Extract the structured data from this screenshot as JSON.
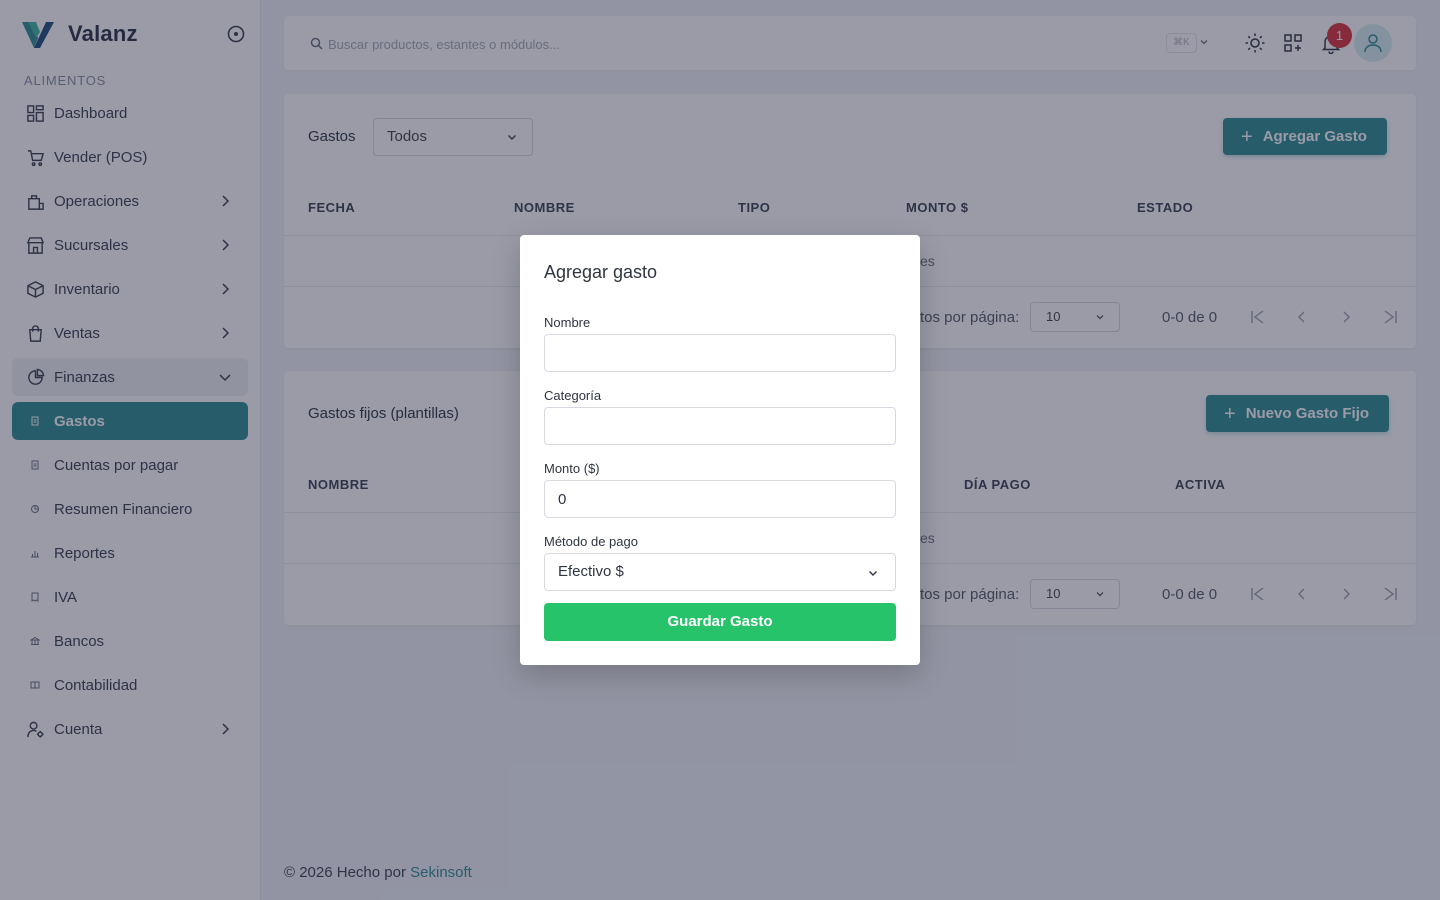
{
  "app": {
    "name": "Valanz"
  },
  "sidebar": {
    "section_label": "ALIMENTOS",
    "items": [
      {
        "label": "Dashboard",
        "icon": "dashboard-icon"
      },
      {
        "label": "Vender (POS)",
        "icon": "cart-icon"
      },
      {
        "label": "Operaciones",
        "icon": "operations-icon"
      },
      {
        "label": "Sucursales",
        "icon": "store-icon"
      },
      {
        "label": "Inventario",
        "icon": "box-icon"
      },
      {
        "label": "Ventas",
        "icon": "bag-icon"
      },
      {
        "label": "Finanzas",
        "icon": "pie-chart-icon"
      },
      {
        "label": "Gastos",
        "icon": "receipt-icon"
      },
      {
        "label": "Cuentas por pagar",
        "icon": "receipt-icon"
      },
      {
        "label": "Resumen Financiero",
        "icon": "pie-chart-icon"
      },
      {
        "label": "Reportes",
        "icon": "bar-chart-icon"
      },
      {
        "label": "IVA",
        "icon": "invoice-icon"
      },
      {
        "label": "Bancos",
        "icon": "bank-icon"
      },
      {
        "label": "Contabilidad",
        "icon": "ledger-icon"
      },
      {
        "label": "Cuenta",
        "icon": "user-gear-icon"
      }
    ]
  },
  "topbar": {
    "search_placeholder": "Buscar productos, estantes o módulos...",
    "shortcut": "⌘K",
    "notifications_count": "1"
  },
  "expenses": {
    "title": "Gastos",
    "filter_value": "Todos",
    "add_button": "Agregar Gasto",
    "columns": [
      "FECHA",
      "NOMBRE",
      "TIPO",
      "MONTO $",
      "ESTADO"
    ],
    "empty_visible": "es",
    "rows_per_page_label": "tos por página:",
    "rows_per_page": "10",
    "range": "0-0 de 0"
  },
  "fixed_expenses": {
    "title": "Gastos fijos (plantillas)",
    "add_button": "Nuevo Gasto Fijo",
    "columns": [
      "NOMBRE",
      "DÍA PAGO",
      "ACTIVA"
    ],
    "empty_visible": "es",
    "rows_per_page_label": "tos por página:",
    "rows_per_page": "10",
    "range": "0-0 de 0"
  },
  "footer": {
    "text": "© 2026 Hecho por ",
    "link": "Sekinsoft"
  },
  "modal": {
    "title": "Agregar gasto",
    "fields": {
      "name_label": "Nombre",
      "name_value": "",
      "category_label": "Categoría",
      "category_value": "",
      "amount_label": "Monto ($)",
      "amount_value": "0",
      "payment_label": "Método de pago",
      "payment_value": "Efectivo $"
    },
    "save_button": "Guardar Gasto"
  },
  "colors": {
    "accent": "#2e8e93",
    "save": "#27c36b",
    "badge": "#d9343b"
  }
}
